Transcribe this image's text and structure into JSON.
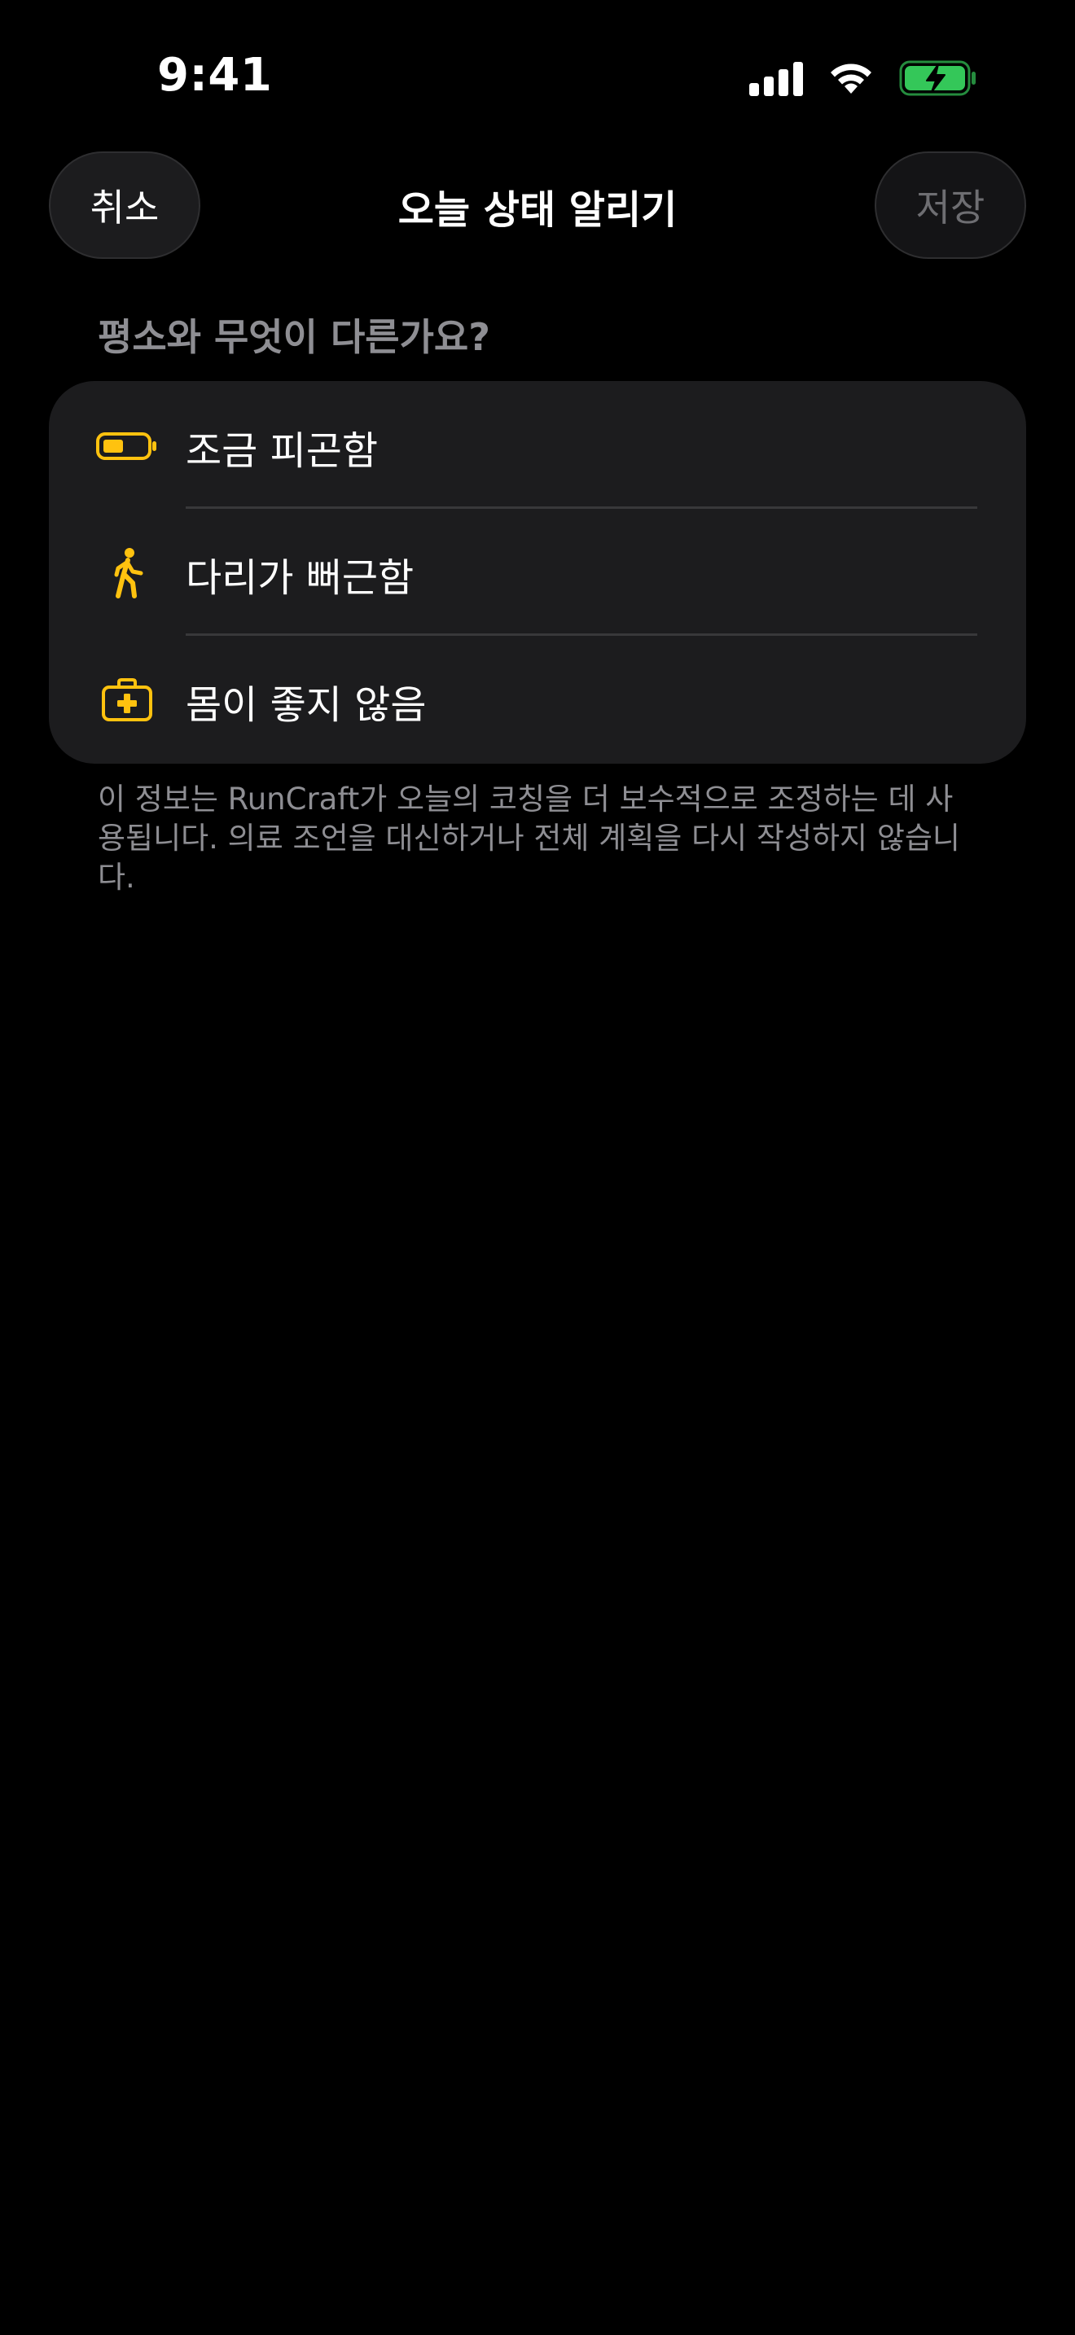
{
  "status_bar": {
    "time": "9:41",
    "battery_color": "#34c759"
  },
  "nav": {
    "cancel_label": "취소",
    "title": "오늘 상태 알리기",
    "save_label": "저장"
  },
  "section_header": "평소와 무엇이 다른가요?",
  "options": [
    {
      "icon": "battery-low-icon",
      "label": "조금 피곤함"
    },
    {
      "icon": "figure-walk-icon",
      "label": "다리가 뻐근함"
    },
    {
      "icon": "medical-kit-icon",
      "label": "몸이 좋지 않음"
    }
  ],
  "footer_note": "이 정보는 RunCraft가 오늘의 코칭을 더 보수적으로 조정하는 데 사용됩니다. 의료 조언을 대신하거나 전체 계획을 다시 작성하지 않습니다.",
  "colors": {
    "accent": "#ffc20f",
    "background": "#000000",
    "card": "#1c1c1e",
    "secondary_text": "#8e8e93"
  }
}
